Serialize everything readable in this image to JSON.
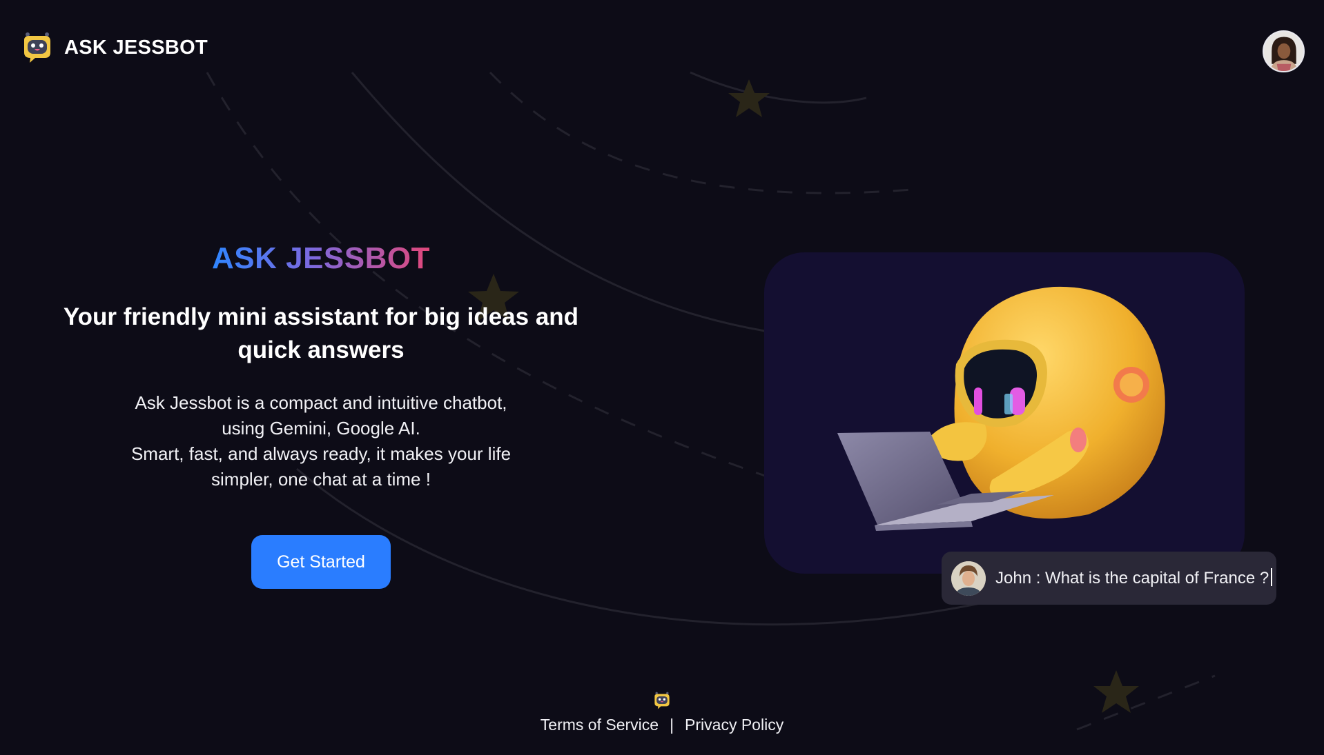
{
  "header": {
    "brand_name": "ASK JESSBOT",
    "brand_logo_icon": "robot-chat-icon",
    "user_avatar": "user-avatar"
  },
  "hero": {
    "title": "ASK JESSBOT",
    "subtitle": "Your friendly mini assistant for big ideas and quick answers",
    "description_lines": [
      "Ask Jessbot is a compact and intuitive chatbot,",
      "using Gemini, Google AI.",
      "Smart, fast, and always ready, it makes your life",
      "simpler, one chat at a time !"
    ],
    "cta_label": "Get Started"
  },
  "illustration": {
    "subject": "robot-with-laptop-illustration"
  },
  "chat_preview": {
    "text": "John : What is the capital of France ?"
  },
  "footer": {
    "terms_label": "Terms of Service",
    "separator": "|",
    "privacy_label": "Privacy Policy"
  },
  "colors": {
    "background": "#0d0c17",
    "accent_blue": "#2a7dff",
    "gradient_start": "#2f86ff",
    "gradient_mid": "#7b6ae0",
    "gradient_end": "#e2487a",
    "illustration_bg": "#140f31",
    "bubble_bg": "#2a2837"
  }
}
